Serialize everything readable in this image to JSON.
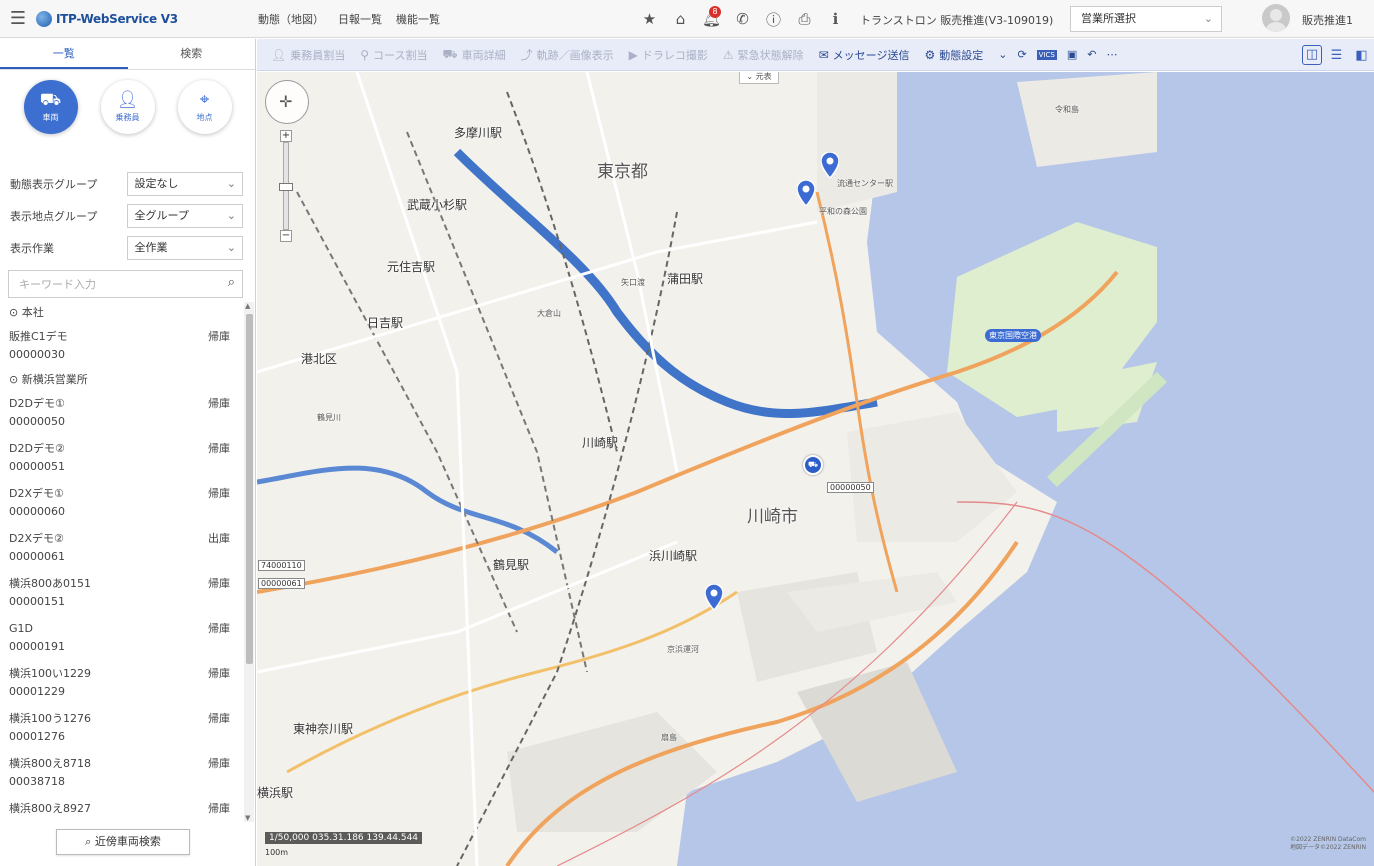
{
  "header": {
    "app_title": "ITP-WebService V3",
    "nav": [
      "動態（地図）",
      "日報一覧",
      "機能一覧"
    ],
    "notification_count": "8",
    "company": "トランストロン 販売推進(V3-109019)",
    "office_select": "営業所選択",
    "user": "販売推進1"
  },
  "sidebar": {
    "tabs": [
      "一覧",
      "検索"
    ],
    "modes": [
      {
        "label": "車両",
        "icon": "truck-icon"
      },
      {
        "label": "乗務員",
        "icon": "person-icon"
      },
      {
        "label": "地点",
        "icon": "target-icon"
      }
    ],
    "filters": [
      {
        "label": "動態表示グループ",
        "value": "設定なし"
      },
      {
        "label": "表示地点グループ",
        "value": "全グループ"
      },
      {
        "label": "表示作業",
        "value": "全作業"
      }
    ],
    "keyword_placeholder": "キーワード入力",
    "groups": [
      {
        "name": "本社",
        "vehicles": [
          {
            "name": "販推C1デモ",
            "id": "00000030",
            "status": "帰庫"
          }
        ]
      },
      {
        "name": "新横浜営業所",
        "vehicles": [
          {
            "name": "D2Dデモ①",
            "id": "00000050",
            "status": "帰庫"
          },
          {
            "name": "D2Dデモ②",
            "id": "00000051",
            "status": "帰庫"
          },
          {
            "name": "D2Xデモ①",
            "id": "00000060",
            "status": "帰庫"
          },
          {
            "name": "D2Xデモ②",
            "id": "00000061",
            "status": "出庫"
          },
          {
            "name": "横浜800あ0151",
            "id": "00000151",
            "status": "帰庫"
          },
          {
            "name": "G1D",
            "id": "00000191",
            "status": "帰庫"
          },
          {
            "name": "横浜100い1229",
            "id": "00001229",
            "status": "帰庫"
          },
          {
            "name": "横浜100う1276",
            "id": "00001276",
            "status": "帰庫"
          },
          {
            "name": "横浜800え8718",
            "id": "00038718",
            "status": "帰庫"
          },
          {
            "name": "横浜800え8927",
            "id": "",
            "status": "帰庫"
          }
        ]
      }
    ],
    "nearby_button": "近傍車両検索"
  },
  "toolbar": {
    "items": [
      {
        "label": "乗務員割当",
        "enabled": false,
        "icon": "person-icon"
      },
      {
        "label": "コース割当",
        "enabled": false,
        "icon": "pin-icon"
      },
      {
        "label": "車両詳細",
        "enabled": false,
        "icon": "truck-icon"
      },
      {
        "label": "軌跡／画像表示",
        "enabled": false,
        "icon": "route-icon"
      },
      {
        "label": "ドラレコ撮影",
        "enabled": false,
        "icon": "camera-icon"
      },
      {
        "label": "緊急状態解除",
        "enabled": false,
        "icon": "alert-icon"
      },
      {
        "label": "メッセージ送信",
        "enabled": true,
        "icon": "mail-icon"
      },
      {
        "label": "動態設定",
        "enabled": true,
        "icon": "gear-icon"
      }
    ]
  },
  "map": {
    "collapse_label": "元表",
    "labels": {
      "tokyo": "東京都",
      "kawasaki_city": "川崎市",
      "musashi_kosugi": "武蔵小杉駅",
      "motosumiyoshi": "元住吉駅",
      "hiyoshi": "日吉駅",
      "kawasaki_st": "川崎駅",
      "tamagawa": "多摩川駅",
      "kamata": "蒲田駅",
      "tsurumi": "鶴見駅",
      "hamakawasaki": "浜川崎駅",
      "higashikanagawa": "東神奈川駅",
      "yokohama": "横浜駅",
      "kohoku": "港北区",
      "haneda": "東京国際空港",
      "reiwajima": "令和島",
      "okurayama": "大倉山",
      "tsurumi_river": "鶴見川",
      "keihin": "京浜運河",
      "ougi": "扇島",
      "ryutsu_center": "流通センター駅",
      "heiwajima": "平和の森公園",
      "yaguchi": "矢口渡"
    },
    "vehicle_tags": [
      "00000050",
      "74000110",
      "00000061"
    ],
    "scale": "1/50,000 035.31.186 139.44.544",
    "scale_sub": "100m",
    "copyright_1": "©2022 ZENRIN DataCom",
    "copyright_2": "地図データ©2022 ZENRIN"
  },
  "colors": {
    "accent": "#3d6fd0",
    "toolbar_bg": "#e8ecf8",
    "sea": "#b5c6e8",
    "land": "#f3f1ec",
    "river": "#3f74c9",
    "expressway": "#f0a35c",
    "airport": "#dfeecf"
  }
}
